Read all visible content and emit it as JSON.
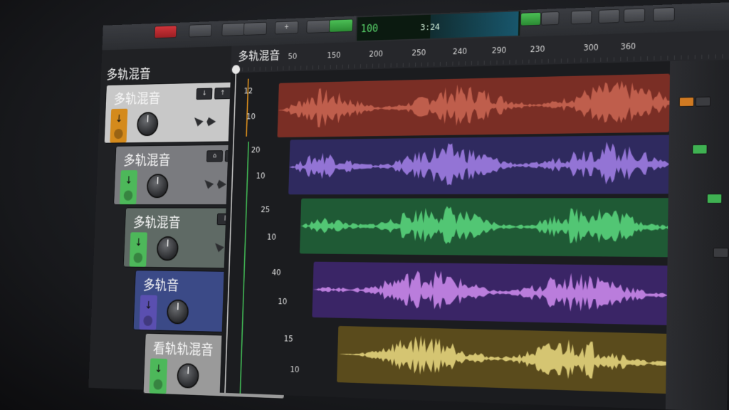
{
  "toolbar": {
    "counter_left": "100",
    "counter_time": "3:24"
  },
  "panel": {
    "title": "多轨混音"
  },
  "timeline": {
    "title": "多轨混音",
    "ticks": [
      "50",
      "150",
      "200",
      "250",
      "240",
      "290",
      "230",
      "300",
      "360"
    ]
  },
  "tracks": [
    {
      "name": "多轨混音",
      "scale_top": "12",
      "scale_bottom": "10",
      "color": "#c4634f",
      "bg": "#7a2e25",
      "header_bg": "#c8c8c8",
      "arm_color": "#d48a1c"
    },
    {
      "name": "多轨混音",
      "scale_top": "20",
      "scale_bottom": "10",
      "color": "#9c7be0",
      "bg": "#2f2a5f",
      "header_bg": "#7a7b7f",
      "arm_color": "#4db85a"
    },
    {
      "name": "多轨混音",
      "scale_top": "25",
      "scale_bottom": "10",
      "color": "#57cf7a",
      "bg": "#1f5a35",
      "header_bg": "#5f6a65",
      "arm_color": "#4db85a"
    },
    {
      "name": "多轨音",
      "scale_top": "40",
      "scale_bottom": "10",
      "color": "#c684e6",
      "bg": "#3a2566",
      "header_bg": "#3b4a87",
      "arm_color": "#5a4fb0"
    },
    {
      "name": "看轨轨混音",
      "scale_top": "15",
      "scale_bottom": "10",
      "color": "#e0cf7a",
      "bg": "#5a4b1c",
      "header_bg": "#9a9a9a",
      "arm_color": "#4db85a"
    }
  ],
  "colors": {
    "accent_green": "#4db85a",
    "accent_red": "#d0343a",
    "accent_orange": "#d48a1c"
  }
}
